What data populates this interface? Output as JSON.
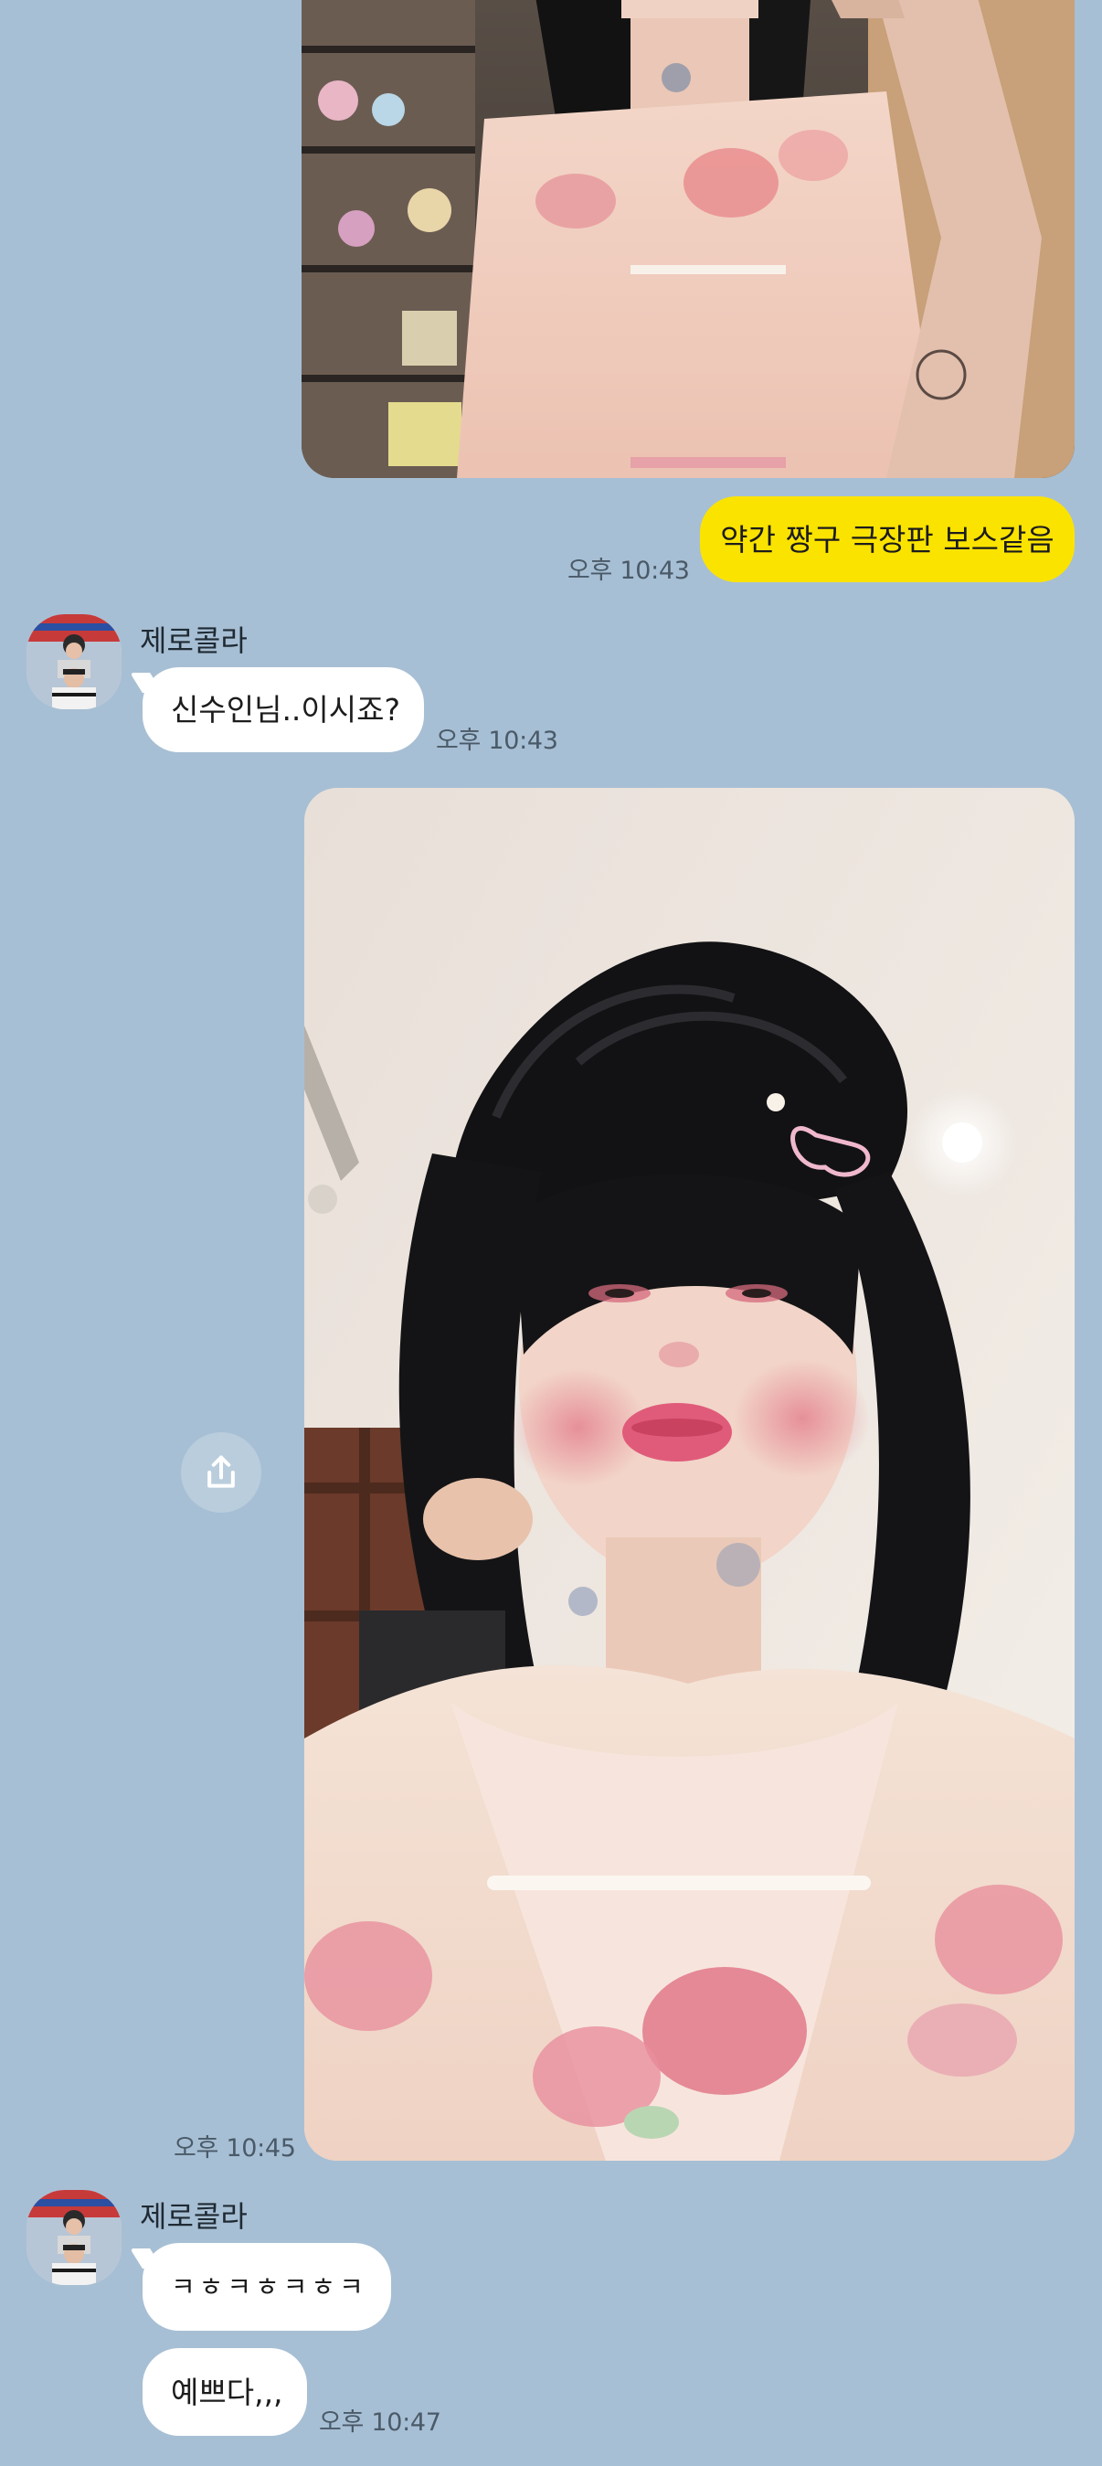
{
  "messages": {
    "top_photo": {
      "kind": "image",
      "direction": "outgoing",
      "alt": "photo"
    },
    "msg1": {
      "direction": "outgoing",
      "text": "약간 짱구 극장판 보스같음",
      "time": "오후 10:43"
    },
    "msg2": {
      "direction": "incoming",
      "sender": "제로콜라",
      "text": "신수인님..이시죠?",
      "time": "오후 10:43"
    },
    "msg3": {
      "kind": "image",
      "direction": "outgoing",
      "time": "오후 10:45"
    },
    "msg4": {
      "direction": "incoming",
      "sender": "제로콜라",
      "text": "ㅋㅎㅋㅎㅋㅎㅋ"
    },
    "msg5": {
      "direction": "incoming",
      "text": "예쁘다,,,",
      "time": "오후 10:47"
    }
  },
  "icons": {
    "share": "share-icon",
    "avatar": "avatar"
  },
  "colors": {
    "background": "#a7bfd4",
    "outgoing_bubble": "#fbe300",
    "incoming_bubble": "#ffffff",
    "time_text": "#4a5a68"
  }
}
